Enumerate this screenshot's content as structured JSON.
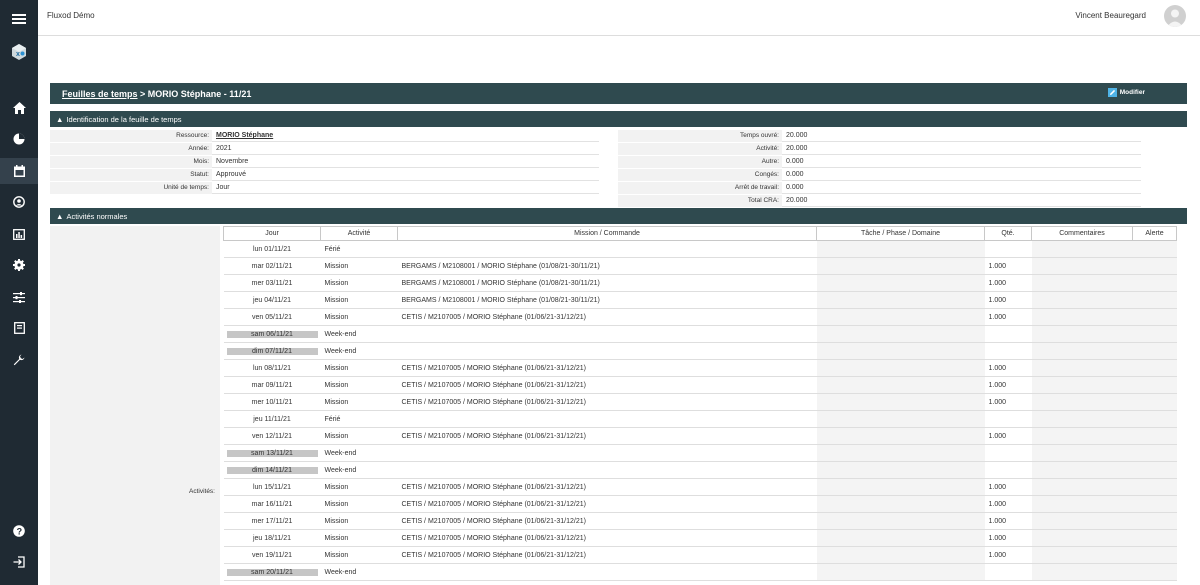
{
  "app": {
    "title": "Fluxod Démo",
    "user": "Vincent Beauregard"
  },
  "sidebar": {
    "items": [
      {
        "name": "menu-icon"
      },
      {
        "name": "logo-icon"
      },
      {
        "name": "home-icon"
      },
      {
        "name": "pie-chart-icon"
      },
      {
        "name": "calendar-icon"
      },
      {
        "name": "user-icon"
      },
      {
        "name": "bar-chart-icon"
      },
      {
        "name": "gear-icon"
      },
      {
        "name": "sliders-icon"
      },
      {
        "name": "book-icon"
      },
      {
        "name": "wrench-icon"
      },
      {
        "name": "help-icon"
      },
      {
        "name": "logout-icon"
      }
    ]
  },
  "header": {
    "breadcrumb_link": "Feuilles de temps",
    "separator": " > ",
    "title": "MORIO Stéphane - 11/21",
    "modify_label": "Modifier"
  },
  "identification": {
    "title": "Identification de la feuille de temps",
    "left": [
      {
        "label": "Ressource:",
        "value": "MORIO Stéphane"
      },
      {
        "label": "Année:",
        "value": "2021"
      },
      {
        "label": "Mois:",
        "value": "Novembre"
      },
      {
        "label": "Statut:",
        "value": "Approuvé"
      },
      {
        "label": "Unité de temps:",
        "value": "Jour"
      }
    ],
    "right": [
      {
        "label": "Temps ouvré:",
        "value": "20.000"
      },
      {
        "label": "Activité:",
        "value": "20.000"
      },
      {
        "label": "Autre:",
        "value": "0.000"
      },
      {
        "label": "Congés:",
        "value": "0.000"
      },
      {
        "label": "Arrêt de travail:",
        "value": "0.000"
      },
      {
        "label": "Total CRA:",
        "value": "20.000"
      }
    ]
  },
  "activities": {
    "title": "Activités normales",
    "label": "Activités:",
    "columns": [
      "Jour",
      "Activité",
      "Mission / Commande",
      "Tâche / Phase / Domaine",
      "Qté.",
      "Commentaires",
      "Alerte"
    ],
    "rows": [
      {
        "day": "lun 01/11/21",
        "activity": "Férié",
        "mission": "",
        "qty": "",
        "weekend": false
      },
      {
        "day": "mar 02/11/21",
        "activity": "Mission",
        "mission": "BERGAMS / M2108001 / MORIO Stéphane (01/08/21-30/11/21)",
        "qty": "1.000",
        "weekend": false
      },
      {
        "day": "mer 03/11/21",
        "activity": "Mission",
        "mission": "BERGAMS / M2108001 / MORIO Stéphane (01/08/21-30/11/21)",
        "qty": "1.000",
        "weekend": false
      },
      {
        "day": "jeu 04/11/21",
        "activity": "Mission",
        "mission": "BERGAMS / M2108001 / MORIO Stéphane (01/08/21-30/11/21)",
        "qty": "1.000",
        "weekend": false
      },
      {
        "day": "ven 05/11/21",
        "activity": "Mission",
        "mission": "CETIS / M2107005 / MORIO Stéphane (01/06/21-31/12/21)",
        "qty": "1.000",
        "weekend": false
      },
      {
        "day": "sam 06/11/21",
        "activity": "Week-end",
        "mission": "",
        "qty": "",
        "weekend": true
      },
      {
        "day": "dim 07/11/21",
        "activity": "Week-end",
        "mission": "",
        "qty": "",
        "weekend": true
      },
      {
        "day": "lun 08/11/21",
        "activity": "Mission",
        "mission": "CETIS / M2107005 / MORIO Stéphane (01/06/21-31/12/21)",
        "qty": "1.000",
        "weekend": false
      },
      {
        "day": "mar 09/11/21",
        "activity": "Mission",
        "mission": "CETIS / M2107005 / MORIO Stéphane (01/06/21-31/12/21)",
        "qty": "1.000",
        "weekend": false
      },
      {
        "day": "mer 10/11/21",
        "activity": "Mission",
        "mission": "CETIS / M2107005 / MORIO Stéphane (01/06/21-31/12/21)",
        "qty": "1.000",
        "weekend": false
      },
      {
        "day": "jeu 11/11/21",
        "activity": "Férié",
        "mission": "",
        "qty": "",
        "weekend": false
      },
      {
        "day": "ven 12/11/21",
        "activity": "Mission",
        "mission": "CETIS / M2107005 / MORIO Stéphane (01/06/21-31/12/21)",
        "qty": "1.000",
        "weekend": false
      },
      {
        "day": "sam 13/11/21",
        "activity": "Week-end",
        "mission": "",
        "qty": "",
        "weekend": true
      },
      {
        "day": "dim 14/11/21",
        "activity": "Week-end",
        "mission": "",
        "qty": "",
        "weekend": true
      },
      {
        "day": "lun 15/11/21",
        "activity": "Mission",
        "mission": "CETIS / M2107005 / MORIO Stéphane (01/06/21-31/12/21)",
        "qty": "1.000",
        "weekend": false
      },
      {
        "day": "mar 16/11/21",
        "activity": "Mission",
        "mission": "CETIS / M2107005 / MORIO Stéphane (01/06/21-31/12/21)",
        "qty": "1.000",
        "weekend": false
      },
      {
        "day": "mer 17/11/21",
        "activity": "Mission",
        "mission": "CETIS / M2107005 / MORIO Stéphane (01/06/21-31/12/21)",
        "qty": "1.000",
        "weekend": false
      },
      {
        "day": "jeu 18/11/21",
        "activity": "Mission",
        "mission": "CETIS / M2107005 / MORIO Stéphane (01/06/21-31/12/21)",
        "qty": "1.000",
        "weekend": false
      },
      {
        "day": "ven 19/11/21",
        "activity": "Mission",
        "mission": "CETIS / M2107005 / MORIO Stéphane (01/06/21-31/12/21)",
        "qty": "1.000",
        "weekend": false
      },
      {
        "day": "sam 20/11/21",
        "activity": "Week-end",
        "mission": "",
        "qty": "",
        "weekend": true
      }
    ]
  },
  "colors": {
    "sidebar": "#1f2a33",
    "sidebar_active": "#34414c",
    "header_bar": "#2f4a4f",
    "weekend_chip": "#c6c6c6",
    "modify_icon": "#4fb3e6"
  }
}
